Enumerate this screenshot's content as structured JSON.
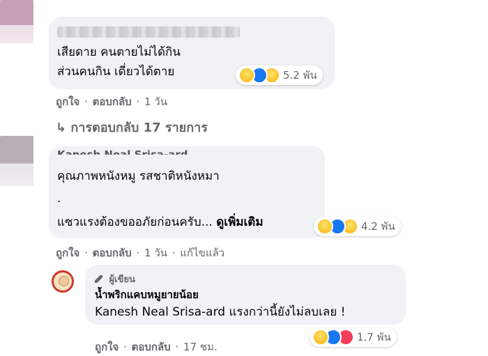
{
  "comments": [
    {
      "lines": [
        "เสียดาย คนตายไม่ได้กิน",
        "ส่วนคนกิน เดี่ยวได้ตาย"
      ],
      "reaction_count": "5.2 พัน",
      "actions": {
        "like": "ถูกใจ",
        "reply": "ตอบกลับ",
        "time": "1 วัน"
      }
    },
    {
      "name_partial": "Kanesh Neal Srisa-ard",
      "lines": [
        "คุณภาพหนังหมู รสชาติหนังหมา",
        ".",
        "แซวแรงต้องขออภัยก่อนครับ..."
      ],
      "see_more": "ดูเพิ่มเติม",
      "reaction_count": "4.2 พัน",
      "actions": {
        "like": "ถูกใจ",
        "reply": "ตอบกลับ",
        "time": "1 วัน",
        "edited": "แก้ไขแล้ว"
      }
    }
  ],
  "replies_link": "การตอบกลับ 17 รายการ",
  "author_reply": {
    "badge": "ผู้เขียน",
    "name": "น้ำพริกแคบหมูยายน้อย",
    "text": "Kanesh Neal Srisa-ard แรงกว่านี้ยังไม่ลบเลย !",
    "reaction_count": "1.7 พัน",
    "actions": {
      "like": "ถูกใจ",
      "reply": "ตอบกลับ",
      "time": "17 ชม."
    }
  },
  "separator": "·",
  "colors": {
    "bubble": "#f0f2f5",
    "meta": "#65676b",
    "like": "#1877f2",
    "love": "#f33e58",
    "haha": "#f7b125"
  }
}
